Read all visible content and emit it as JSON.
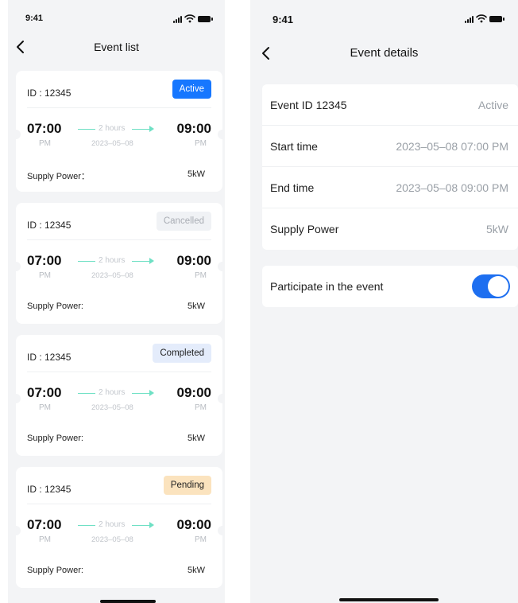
{
  "left": {
    "status_time": "9:41",
    "title": "Event list",
    "events": [
      {
        "id": "ID : 12345",
        "status": "Active",
        "status_key": "active",
        "start": "07:00",
        "start_ampm": "PM",
        "duration": "2 hours",
        "date": "2023–05–08",
        "end": "09:00",
        "end_ampm": "PM",
        "supply_label": "Supply Power：",
        "supply_value": "5kW"
      },
      {
        "id": "ID : 12345",
        "status": "Cancelled",
        "status_key": "cancelled",
        "start": "07:00",
        "start_ampm": "PM",
        "duration": "2 hours",
        "date": "2023–05–08",
        "end": "09:00",
        "end_ampm": "PM",
        "supply_label": "Supply Power:",
        "supply_value": "5kW"
      },
      {
        "id": "ID : 12345",
        "status": "Completed",
        "status_key": "completed",
        "start": "07:00",
        "start_ampm": "PM",
        "duration": "2 hours",
        "date": "2023–05–08",
        "end": "09:00",
        "end_ampm": "PM",
        "supply_label": "Supply Power:",
        "supply_value": "5kW"
      },
      {
        "id": "ID : 12345",
        "status": "Pending",
        "status_key": "pending",
        "start": "07:00",
        "start_ampm": "PM",
        "duration": "2 hours",
        "date": "2023–05–08",
        "end": "09:00",
        "end_ampm": "PM",
        "supply_label": "Supply Power:",
        "supply_value": "5kW"
      }
    ],
    "status_colors": {
      "active": "#1677ff",
      "cancelled": "#f0f2f5",
      "completed": "#e4ecfb",
      "pending": "#fbe3be"
    }
  },
  "right": {
    "status_time": "9:41",
    "title": "Event details",
    "details": [
      {
        "label": "Event ID 12345",
        "value": "Active"
      },
      {
        "label": "Start time",
        "value": "2023–05–08  07:00 PM"
      },
      {
        "label": "End time",
        "value": "2023–05–08  09:00 PM"
      },
      {
        "label": "Supply Power",
        "value": "5kW"
      }
    ],
    "participate": {
      "label": "Participate in the event",
      "enabled": true
    },
    "accent_color": "#1e6ff0"
  },
  "icons": [
    "back-chevron-icon",
    "signal-icon",
    "wifi-icon",
    "battery-icon"
  ]
}
